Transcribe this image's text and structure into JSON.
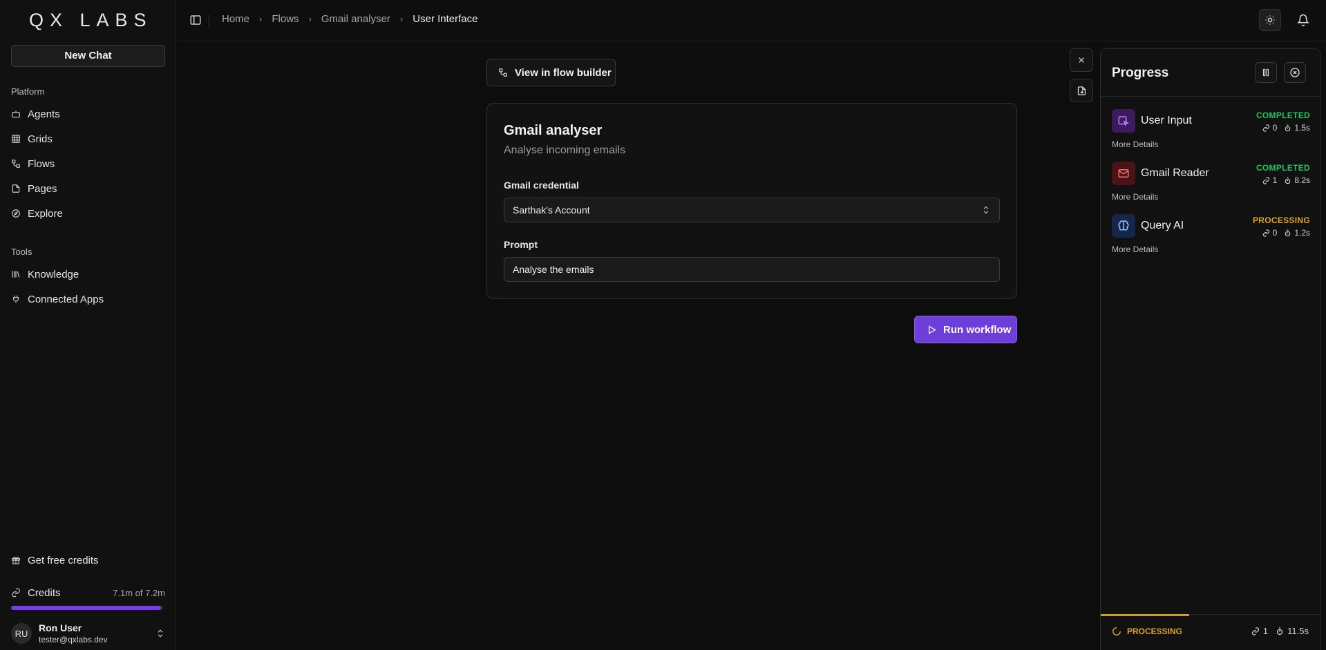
{
  "brand": {
    "logo": "QX LABS"
  },
  "sidebar": {
    "new_chat": "New Chat",
    "platform_label": "Platform",
    "platform_items": [
      {
        "label": "Agents",
        "icon": "bot-icon"
      },
      {
        "label": "Grids",
        "icon": "grid-icon"
      },
      {
        "label": "Flows",
        "icon": "flow-icon"
      },
      {
        "label": "Pages",
        "icon": "pages-icon"
      },
      {
        "label": "Explore",
        "icon": "compass-icon"
      }
    ],
    "tools_label": "Tools",
    "tools_items": [
      {
        "label": "Knowledge",
        "icon": "library-icon"
      },
      {
        "label": "Connected Apps",
        "icon": "plug-icon"
      }
    ],
    "get_free_credits": "Get free credits",
    "credits": {
      "label": "Credits",
      "amount": "7.1m of 7.2m",
      "fraction": 0.986
    },
    "user": {
      "initials": "RU",
      "name": "Ron User",
      "email": "tester@qxlabs.dev"
    }
  },
  "header": {
    "breadcrumb": [
      "Home",
      "Flows",
      "Gmail analyser",
      "User Interface"
    ]
  },
  "main": {
    "view_flow_builder": "View in flow builder",
    "card": {
      "title": "Gmail analyser",
      "subtitle": "Analyse incoming emails",
      "credential_label": "Gmail credential",
      "credential_value": "Sarthak's Account",
      "prompt_label": "Prompt",
      "prompt_value": "Analyse the emails"
    },
    "run_button": "Run workflow"
  },
  "progress": {
    "title": "Progress",
    "steps": [
      {
        "name": "User Input",
        "status": "COMPLETED",
        "links": "0",
        "time": "1.5s",
        "more": "More Details",
        "icon": "user-input-icon"
      },
      {
        "name": "Gmail Reader",
        "status": "COMPLETED",
        "links": "1",
        "time": "8.2s",
        "more": "More Details",
        "icon": "mail-icon"
      },
      {
        "name": "Query AI",
        "status": "PROCESSING",
        "links": "0",
        "time": "1.2s",
        "more": "More Details",
        "icon": "brain-icon"
      }
    ],
    "footer": {
      "status": "PROCESSING",
      "links": "1",
      "time": "11.5s"
    }
  },
  "colors": {
    "accent": "#6d3fd8",
    "completed": "#22c55e",
    "processing": "#e0a422"
  }
}
